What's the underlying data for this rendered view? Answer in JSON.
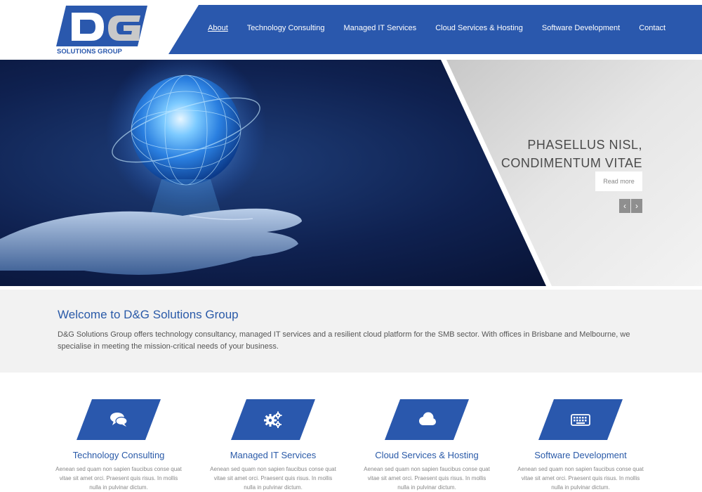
{
  "logo": {
    "letters": "DG",
    "tagline": "SOLUTIONS GROUP"
  },
  "nav": {
    "items": [
      {
        "label": "About",
        "active": true
      },
      {
        "label": "Technology Consulting",
        "active": false
      },
      {
        "label": "Managed IT Services",
        "active": false
      },
      {
        "label": "Cloud Services & Hosting",
        "active": false
      },
      {
        "label": "Software Development",
        "active": false
      },
      {
        "label": "Contact",
        "active": false
      }
    ]
  },
  "hero": {
    "title_line1": "PHASELLUS NISL,",
    "title_line2": "CONDIMENTUM VITAE",
    "read_more": "Read more",
    "prev_icon": "chevron-left-icon",
    "next_icon": "chevron-right-icon"
  },
  "welcome": {
    "heading": "Welcome to D&G Solutions Group",
    "body": "D&G Solutions Group offers technology consultancy, managed IT services and a resilient cloud platform for the SMB sector. With offices in Brisbane and Melbourne, we specialise in meeting the mission-critical needs of your business."
  },
  "services": [
    {
      "title": "Technology Consulting",
      "icon": "speech-bubbles-icon",
      "text": "Aenean sed quam non sapien faucibus conse quat vitae sit amet orci. Praesent quis risus. In mollis nulla in pulvinar dictum."
    },
    {
      "title": "Managed IT Services",
      "icon": "gears-icon",
      "text": "Aenean sed quam non sapien faucibus conse quat vitae sit amet orci. Praesent quis risus. In mollis nulla in pulvinar dictum."
    },
    {
      "title": "Cloud Services & Hosting",
      "icon": "cloud-icon",
      "text": "Aenean sed quam non sapien faucibus conse quat vitae sit amet orci. Praesent quis risus. In mollis nulla in pulvinar dictum."
    },
    {
      "title": "Software Development",
      "icon": "keyboard-icon",
      "text": "Aenean sed quam non sapien faucibus conse quat vitae sit amet orci. Praesent quis risus. In mollis nulla in pulvinar dictum."
    }
  ],
  "colors": {
    "brand_blue": "#2a58ad",
    "heading_blue": "#2a5aa8",
    "hero_dark": "#0d1a3a",
    "panel_grey": "#d9d9d9"
  }
}
